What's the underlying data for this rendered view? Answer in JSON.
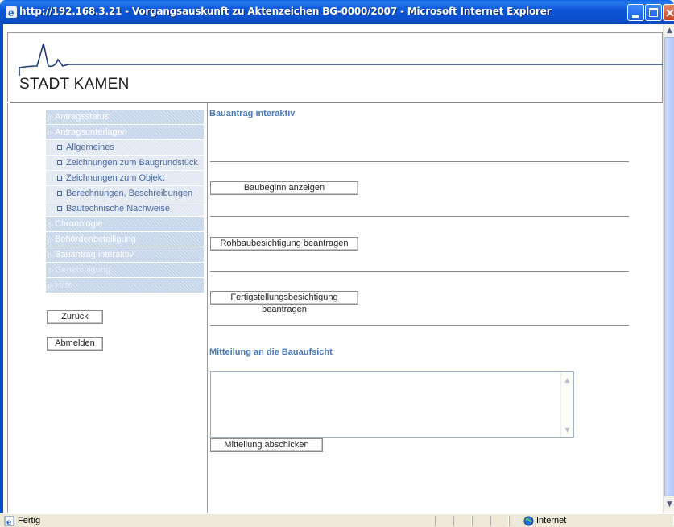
{
  "window": {
    "title": "http://192.168.3.21 - Vorgangsauskunft zu Aktenzeichen BG-0000/2007 - Microsoft Internet Explorer"
  },
  "header": {
    "logo_text": "STADT KAMEN"
  },
  "nav": {
    "items": [
      {
        "label": "Antragsstatus",
        "type": "section"
      },
      {
        "label": "Antragsunterlagen",
        "type": "section"
      },
      {
        "label": "Allgemeines",
        "type": "sub"
      },
      {
        "label": "Zeichnungen zum Baugrundstück",
        "type": "sub"
      },
      {
        "label": "Zeichnungen zum Objekt",
        "type": "sub"
      },
      {
        "label": "Berechnungen, Beschreibungen",
        "type": "sub"
      },
      {
        "label": "Bautechnische Nachweise",
        "type": "sub"
      },
      {
        "label": "Chronologie",
        "type": "section"
      },
      {
        "label": "Behördenbeteiligung",
        "type": "section"
      },
      {
        "label": "Bauantrag interaktiv",
        "type": "section"
      },
      {
        "label": "Genehmigung",
        "type": "section-dim"
      },
      {
        "label": "Hilfe",
        "type": "section-dim"
      }
    ],
    "back_label": "Zurück",
    "logout_label": "Abmelden"
  },
  "main": {
    "section_title": "Bauantrag interaktiv",
    "actions": {
      "baubeginn": "Baubeginn anzeigen",
      "rohbau": "Rohbaubesichtigung beantragen",
      "fertigstellung": "Fertigstellungsbesichtigung beantragen"
    },
    "message": {
      "title": "Mitteilung an die Bauaufsicht",
      "value": "",
      "send_label": "Mitteilung abschicken"
    }
  },
  "statusbar": {
    "status": "Fertig",
    "zone": "Internet"
  }
}
